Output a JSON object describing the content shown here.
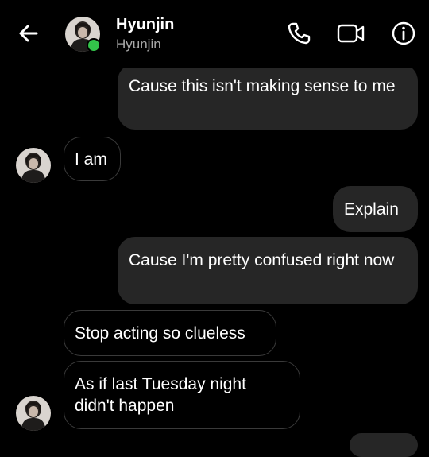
{
  "header": {
    "name": "Hyunjin",
    "username": "Hyunjin",
    "online": true,
    "icons": [
      "back-arrow-icon",
      "phone-icon",
      "video-call-icon",
      "info-icon"
    ]
  },
  "messages": [
    {
      "side": "out",
      "text": "Cause this isn't making sense to me"
    },
    {
      "side": "in",
      "text": "I am"
    },
    {
      "side": "out",
      "text": "Explain"
    },
    {
      "side": "out",
      "text": "Cause I'm pretty confused right now"
    },
    {
      "side": "in",
      "text": "Stop acting so clueless"
    },
    {
      "side": "in",
      "text": "As if last Tuesday night didn't happen"
    }
  ],
  "colors": {
    "background": "#000000",
    "outgoing_bubble": "#262626",
    "incoming_border": "#3a3a3a",
    "online_indicator": "#33c34a",
    "secondary_text": "#a8a8a8"
  }
}
